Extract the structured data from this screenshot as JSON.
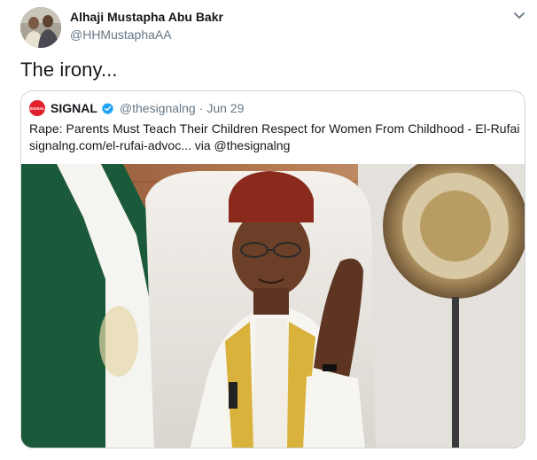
{
  "author": {
    "name": "Alhaji Mustapha Abu Bakr",
    "handle": "@HHMustaphaAA"
  },
  "tweet": {
    "text": "The irony..."
  },
  "quoted_tweet": {
    "logo_text": "SIGNAL",
    "name": "SIGNAL",
    "handle": "@thesignalng",
    "separator": "·",
    "date": "Jun 29",
    "text_line1": "Rape: Parents Must Teach Their Children Respect for Women From Childhood - El-Rufai",
    "text_line2": "signalng.com/el-rufai-advoc... via @thesignalng",
    "image_alt": "Man in a red cap and white robe with gold embroidery gesturing, seated before a state seal"
  },
  "icons": {
    "avatar": "avatar-photo",
    "menu": "chevron-down-icon",
    "verified": "verified-badge-icon"
  },
  "colors": {
    "text": "#14171a",
    "secondary": "#657786",
    "border": "#ccd6dd",
    "verified": "#1da1f2",
    "signal_red": "#e0202a"
  }
}
